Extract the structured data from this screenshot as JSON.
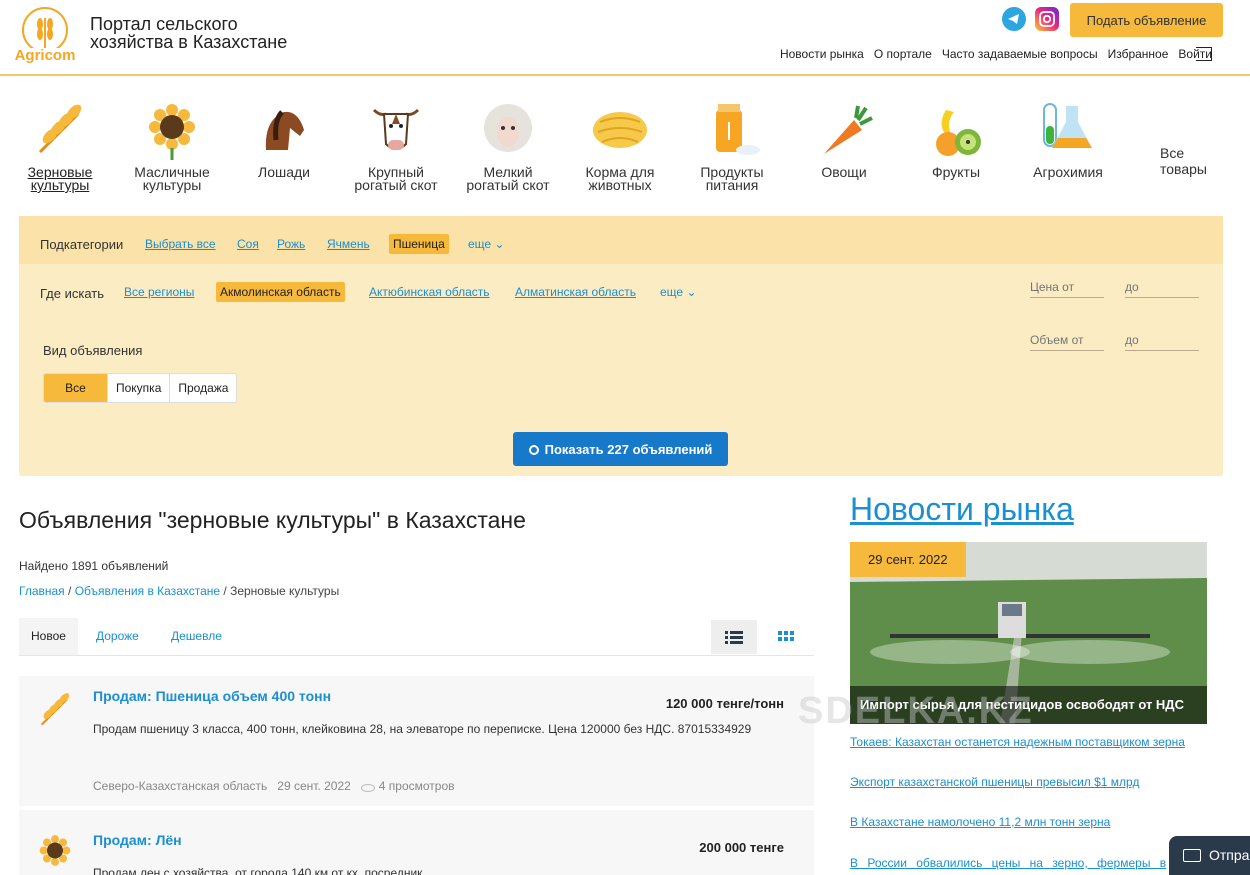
{
  "header": {
    "logo_text": "Agricom",
    "site_title": "Портал сельского хозяйства в Казахстане",
    "post_button": "Подать объявление",
    "nav": [
      "Новости рынка",
      "О портале",
      "Часто задаваемые вопросы",
      "Избранное",
      "Войти"
    ]
  },
  "categories": [
    {
      "label": "Зерновые культуры",
      "icon": "wheat-icon",
      "active": true
    },
    {
      "label": "Масличные культуры",
      "icon": "sunflower-icon"
    },
    {
      "label": "Лошади",
      "icon": "horse-icon"
    },
    {
      "label": "Крупный рогатый скот",
      "icon": "cow-icon"
    },
    {
      "label": "Мелкий рогатый скот",
      "icon": "sheep-icon"
    },
    {
      "label": "Корма для животных",
      "icon": "hay-bale-icon"
    },
    {
      "label": "Продукты питания",
      "icon": "flour-bag-icon"
    },
    {
      "label": "Овощи",
      "icon": "carrot-icon"
    },
    {
      "label": "Фрукты",
      "icon": "fruits-icon"
    },
    {
      "label": "Агрохимия",
      "icon": "flask-icon"
    }
  ],
  "all_goods": "Все товары",
  "filter": {
    "subcat_label": "Подкатегории",
    "subcats": [
      "Выбрать все",
      "Соя",
      "Рожь",
      "Ячмень",
      "Пшеница"
    ],
    "subcat_selected": "Пшеница",
    "more": "еще",
    "where_label": "Где искать",
    "regions": [
      "Все регионы",
      "Акмолинская область",
      "Актюбинская область",
      "Алматинская область"
    ],
    "region_selected": "Акмолинская область",
    "price_from": "Цена от",
    "price_to": "до",
    "volume_from": "Объем от",
    "volume_to": "до",
    "ad_type_label": "Вид объявления",
    "ad_types": [
      "Все",
      "Покупка",
      "Продажа"
    ],
    "ad_type_selected": "Все",
    "show_button": "Показать 227 объявлений"
  },
  "main": {
    "title": "Объявления \"зерновые культуры\" в Казахстане",
    "found": "Найдено 1891 объявлений",
    "breadcrumbs": [
      "Главная",
      "Объявления в Казахстане",
      "Зерновые культуры"
    ],
    "sort": [
      "Новое",
      "Дороже",
      "Дешевле"
    ],
    "sort_selected": "Новое",
    "listings": [
      {
        "title": "Продам: Пшеница объем 400 тонн",
        "price": "120 000 тенге/тонн",
        "desc": "Продам пшеницу 3 класса, 400 тонн, клейковина 28, на элеваторе по переписке. Цена 120000 без НДС. 87015334929",
        "region": "Северо-Казахстанская область",
        "date": "29 сент. 2022",
        "views": "4 просмотров",
        "icon": "wheat-icon"
      },
      {
        "title": "Продам: Лён",
        "price": "200 000 тенге",
        "desc": "Продам лен с хозяйства, от города 140 км от кх, посредник",
        "icon": "sunflower-icon"
      }
    ]
  },
  "news": {
    "heading": "Новости рынка",
    "featured_date": "29 сент. 2022",
    "featured_caption": "Импорт сырья для пестицидов освободят от НДС",
    "watermark": "SDELKA.KZ",
    "links": [
      "Токаев: Казахстан останется надежным поставщиком зерна",
      "Экспорт казахстанской пшеницы превысил $1 млрд",
      "В Казахстане намолочено 11,2 млн тонн зерна",
      "В России обвалились цены на зерно, фермеры в"
    ]
  },
  "send_button": "Отпра"
}
